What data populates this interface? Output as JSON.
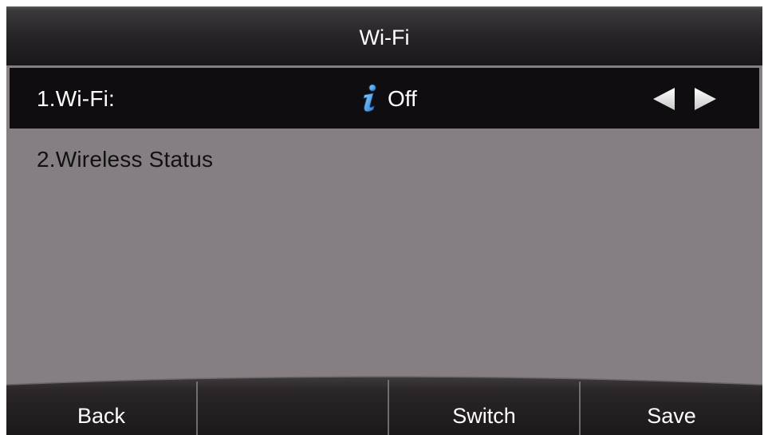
{
  "header": {
    "title": "Wi-Fi"
  },
  "menu": {
    "items": [
      {
        "label": "1.Wi-Fi:",
        "value": "Off",
        "icon": "info-icon",
        "selected": true
      },
      {
        "label": "2.Wireless Status",
        "selected": false
      }
    ]
  },
  "softkeys": [
    {
      "label": "Back"
    },
    {
      "label": ""
    },
    {
      "label": "Switch"
    },
    {
      "label": "Save"
    }
  ],
  "colors": {
    "screen_background": "#857f83",
    "selected_row": "#0f0d0f",
    "bar_background": "#1c1a1c",
    "info_icon": "#4aa3e8",
    "text_light": "#ffffff",
    "text_dark": "#111111"
  }
}
